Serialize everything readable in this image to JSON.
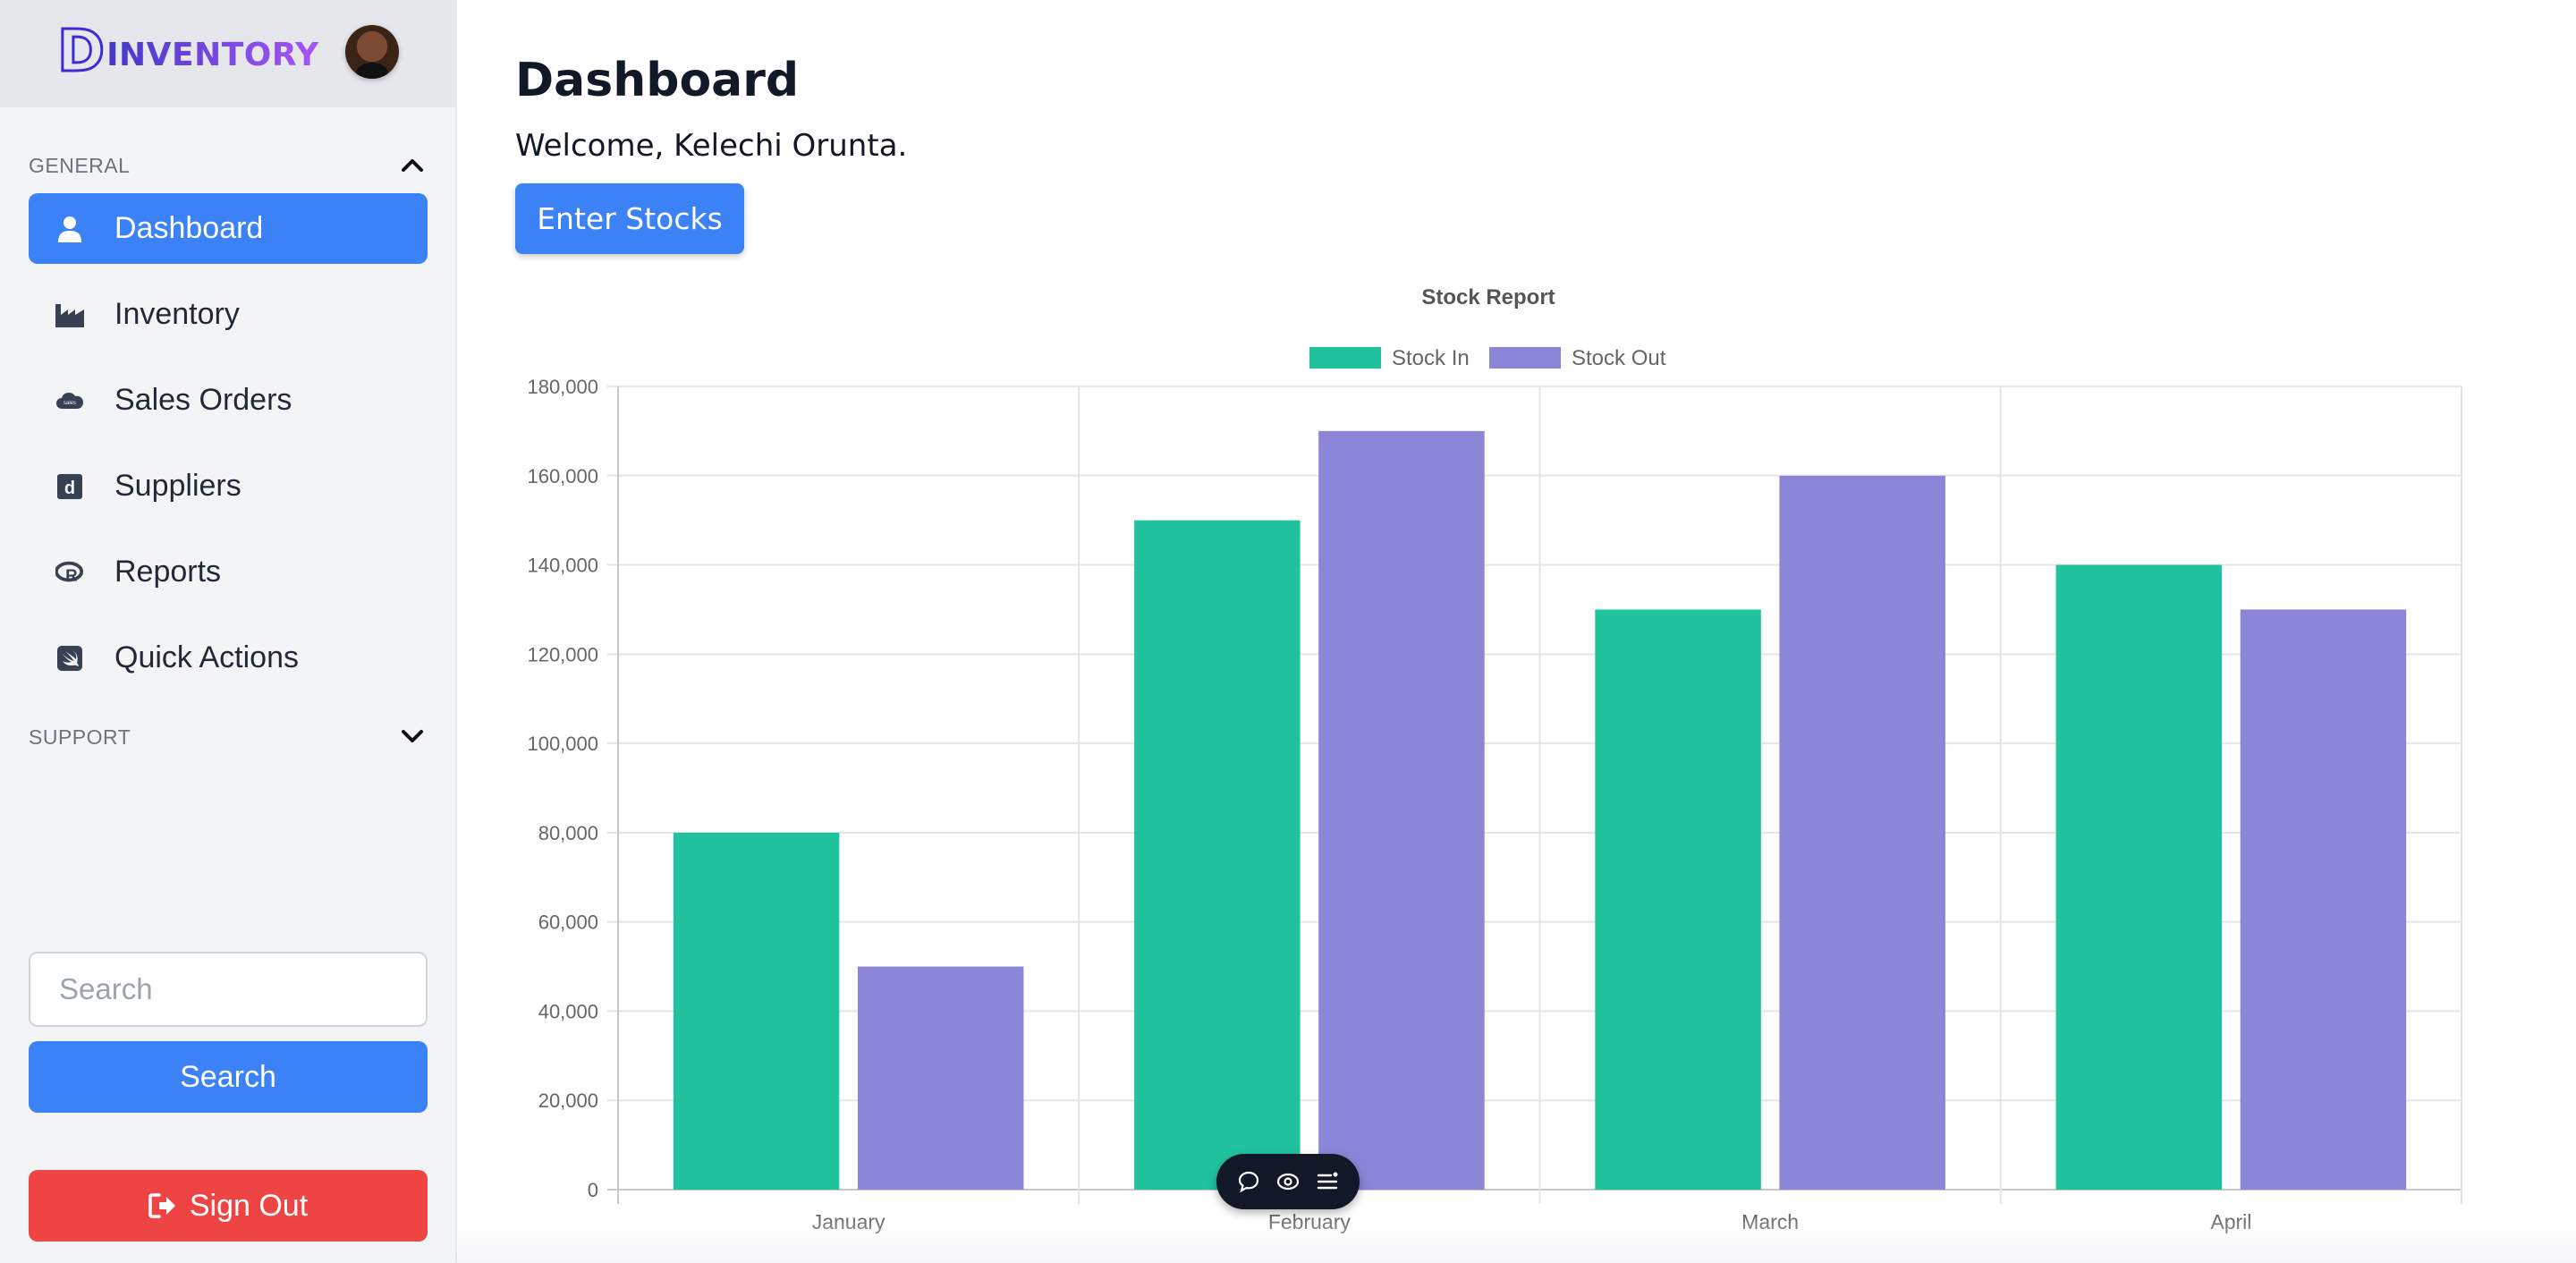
{
  "app": {
    "logo_letter": "D",
    "logo_text": "INVENTORY"
  },
  "sidebar": {
    "general_label": "GENERAL",
    "support_label": "SUPPORT",
    "items": [
      {
        "label": "Dashboard",
        "icon": "user-icon",
        "active": true
      },
      {
        "label": "Inventory",
        "icon": "factory-icon",
        "active": false
      },
      {
        "label": "Sales Orders",
        "icon": "salesforce-cloud-icon",
        "active": false
      },
      {
        "label": "Suppliers",
        "icon": "dailymotion-d-icon",
        "active": false
      },
      {
        "label": "Reports",
        "icon": "r-project-icon",
        "active": false
      },
      {
        "label": "Quick Actions",
        "icon": "swift-icon",
        "active": false
      }
    ],
    "search": {
      "placeholder": "Search",
      "value": ""
    },
    "search_button": "Search",
    "signout_button": "Sign Out"
  },
  "main": {
    "title": "Dashboard",
    "welcome": "Welcome, Kelechi Orunta.",
    "enter_button": "Enter Stocks"
  },
  "colors": {
    "primary": "#3b82f6",
    "danger": "#ef4444",
    "stock_in": "#20c39d",
    "stock_out": "#8a85d6"
  },
  "chart_data": {
    "type": "bar",
    "title": "Stock Report",
    "categories": [
      "January",
      "February",
      "March",
      "April"
    ],
    "series": [
      {
        "name": "Stock In",
        "values": [
          80000,
          150000,
          130000,
          140000
        ],
        "color": "#20c39d"
      },
      {
        "name": "Stock Out",
        "values": [
          50000,
          170000,
          160000,
          130000
        ],
        "color": "#8a85d6"
      }
    ],
    "ylim": [
      0,
      180000
    ],
    "yticks": [
      "0",
      "20,000",
      "40,000",
      "60,000",
      "80,000",
      "100,000",
      "120,000",
      "140,000",
      "160,000",
      "180,000"
    ],
    "legend_position": "top-center",
    "grid": true,
    "xlabel": "",
    "ylabel": ""
  },
  "floating_toolbar": {
    "icons": [
      "comment-icon",
      "eye-icon",
      "menu-icon"
    ]
  }
}
